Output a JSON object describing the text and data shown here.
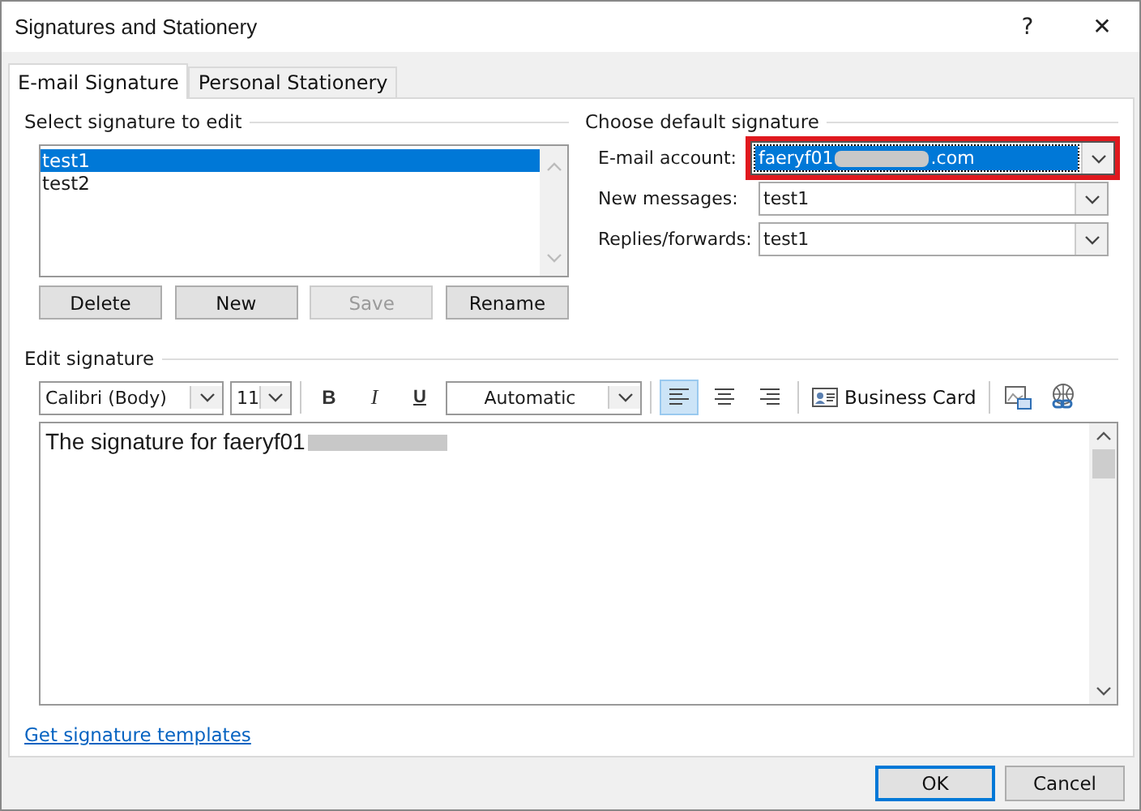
{
  "window": {
    "title": "Signatures and Stationery",
    "help": "?",
    "close": "✕"
  },
  "tabs": [
    {
      "label": "E-mail Signature",
      "selected": true
    },
    {
      "label": "Personal Stationery",
      "selected": false
    }
  ],
  "select_signature": {
    "heading": "Select signature to edit",
    "items": [
      {
        "label": "test1",
        "selected": true
      },
      {
        "label": "test2",
        "selected": false
      }
    ],
    "buttons": [
      {
        "label": "Delete",
        "disabled": false
      },
      {
        "label": "New",
        "disabled": false
      },
      {
        "label": "Save",
        "disabled": true
      },
      {
        "label": "Rename",
        "disabled": false
      }
    ]
  },
  "default_signature": {
    "heading": "Choose default signature",
    "fields": [
      {
        "label": "E-mail account:",
        "value_parts": [
          "faeryf01",
          ".com"
        ],
        "redacted": true,
        "highlighted": true
      },
      {
        "label": "New messages:",
        "value_parts": [
          "test1"
        ],
        "highlighted": false
      },
      {
        "label": "Replies/forwards:",
        "value_parts": [
          "test1"
        ],
        "highlighted": false
      }
    ]
  },
  "edit_signature": {
    "heading": "Edit signature",
    "font": "Calibri (Body)",
    "size": "11",
    "color_label": "Automatic",
    "format_buttons": [
      {
        "kind": "bold",
        "label": "B"
      },
      {
        "kind": "italic",
        "label": "I"
      },
      {
        "kind": "underline",
        "label": "U"
      }
    ],
    "align": [
      {
        "kind": "left",
        "selected": true
      },
      {
        "kind": "center",
        "selected": false
      },
      {
        "kind": "right",
        "selected": false
      }
    ],
    "business_card": "Business Card",
    "text_parts": [
      "The signature for faeryf01"
    ],
    "redacted": true
  },
  "link": "Get signature templates",
  "buttons": [
    {
      "label": "OK",
      "default": true
    },
    {
      "label": "Cancel",
      "default": false
    }
  ]
}
